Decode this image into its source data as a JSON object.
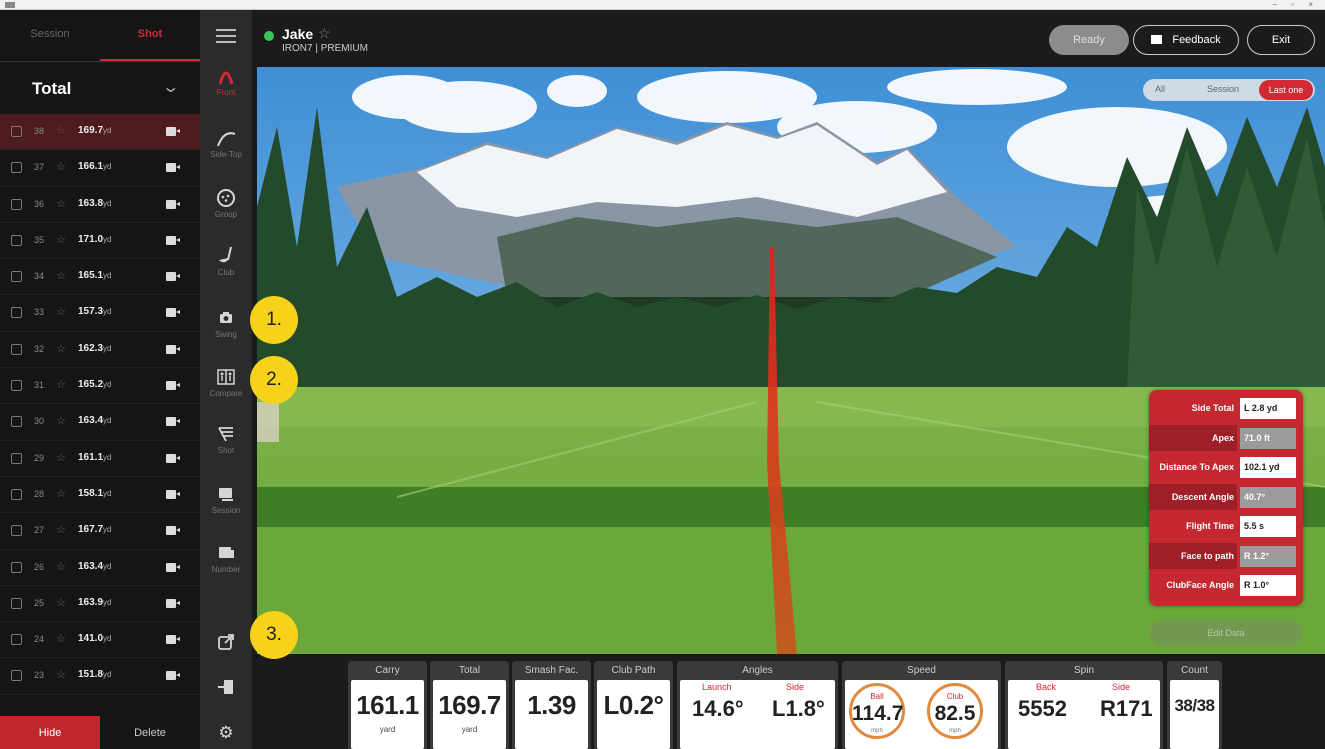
{
  "left_panel": {
    "tabs": [
      "Session",
      "Shot"
    ],
    "filter_label": "Total",
    "shots": [
      {
        "num": "38",
        "dist": "169.7",
        "unit": "yd"
      },
      {
        "num": "37",
        "dist": "166.1",
        "unit": "yd"
      },
      {
        "num": "36",
        "dist": "163.8",
        "unit": "yd"
      },
      {
        "num": "35",
        "dist": "171.0",
        "unit": "yd"
      },
      {
        "num": "34",
        "dist": "165.1",
        "unit": "yd"
      },
      {
        "num": "33",
        "dist": "157.3",
        "unit": "yd"
      },
      {
        "num": "32",
        "dist": "162.3",
        "unit": "yd"
      },
      {
        "num": "31",
        "dist": "165.2",
        "unit": "yd"
      },
      {
        "num": "30",
        "dist": "163.4",
        "unit": "yd"
      },
      {
        "num": "29",
        "dist": "161.1",
        "unit": "yd"
      },
      {
        "num": "28",
        "dist": "158.1",
        "unit": "yd"
      },
      {
        "num": "27",
        "dist": "167.7",
        "unit": "yd"
      },
      {
        "num": "26",
        "dist": "163.4",
        "unit": "yd"
      },
      {
        "num": "25",
        "dist": "163.9",
        "unit": "yd"
      },
      {
        "num": "24",
        "dist": "141.0",
        "unit": "yd"
      },
      {
        "num": "23",
        "dist": "151.8",
        "unit": "yd"
      }
    ],
    "hide_label": "Hide",
    "delete_label": "Delete"
  },
  "iconbar": {
    "items": [
      {
        "label": "Front",
        "icon": "arc-icon"
      },
      {
        "label": "Side-Top",
        "icon": "side-arc-icon"
      },
      {
        "label": "Group",
        "icon": "group-icon"
      },
      {
        "label": "Club",
        "icon": "club-icon"
      },
      {
        "label": "Swing",
        "icon": "camera-icon"
      },
      {
        "label": "Compare",
        "icon": "compare-icon"
      },
      {
        "label": "Shot",
        "icon": "shot-list-icon"
      },
      {
        "label": "Session",
        "icon": "session-icon"
      },
      {
        "label": "Number",
        "icon": "number-icon"
      }
    ]
  },
  "header": {
    "player": "Jake",
    "club": "IRON7 | PREMIUM",
    "ready_label": "Ready",
    "feedback_label": "Feedback",
    "exit_label": "Exit"
  },
  "view_toggle": {
    "options": [
      "All",
      "Session",
      "Last one"
    ],
    "selected": "Last one"
  },
  "stats_panel": {
    "rows": [
      {
        "label": "Side Total",
        "value": "L 2.8 yd"
      },
      {
        "label": "Apex",
        "value": "71.0 ft"
      },
      {
        "label": "Distance To Apex",
        "value": "102.1 yd"
      },
      {
        "label": "Descent Angle",
        "value": "40.7°"
      },
      {
        "label": "Flight Time",
        "value": "5.5 s"
      },
      {
        "label": "Face to path",
        "value": "R 1.2°"
      },
      {
        "label": "ClubFace Angle",
        "value": "R 1.0°"
      }
    ],
    "edit_label": "Edit Data"
  },
  "metrics": {
    "carry": {
      "title": "Carry",
      "value": "161.1",
      "unit": "yard"
    },
    "total": {
      "title": "Total",
      "value": "169.7",
      "unit": "yard"
    },
    "smash": {
      "title": "Smash Fac.",
      "value": "1.39"
    },
    "club_path": {
      "title": "Club Path",
      "value": "L0.2°"
    },
    "angles": {
      "title": "Angles",
      "launch_label": "Launch",
      "launch_value": "14.6°",
      "side_label": "Side",
      "side_value": "L1.8°"
    },
    "speed": {
      "title": "Speed",
      "ball_label": "Ball",
      "ball_value": "114.7",
      "club_label": "Club",
      "club_value": "82.5",
      "unit": "mph"
    },
    "spin": {
      "title": "Spin",
      "back_label": "Back",
      "back_value": "5552",
      "side_label": "Side",
      "side_value": "R171"
    },
    "count": {
      "title": "Count",
      "value": "38/38"
    }
  },
  "callouts": [
    "1.",
    "2.",
    "3."
  ],
  "colors": {
    "accent": "#d12a35",
    "ready_dot": "#3ac55a",
    "callout": "#f6d21b"
  }
}
